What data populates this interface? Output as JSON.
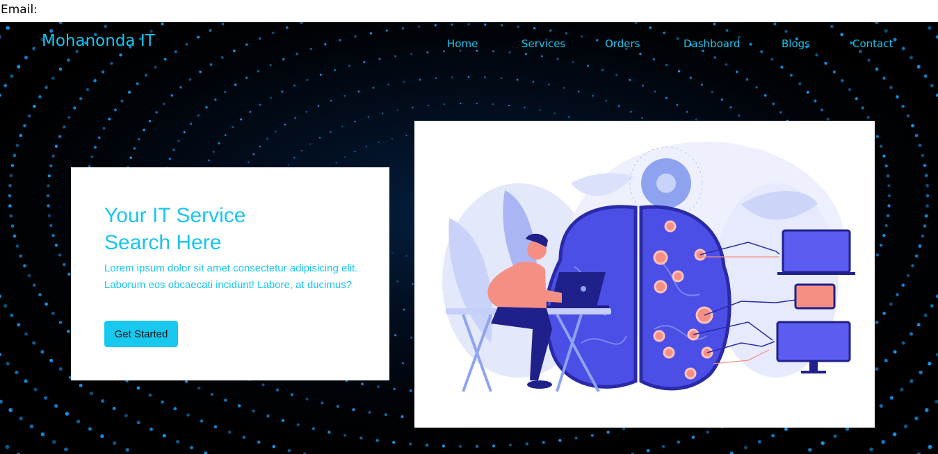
{
  "top_strip": {
    "email_label": "Email:"
  },
  "header": {
    "brand": "Mohanonda IT",
    "nav": [
      {
        "label": "Home"
      },
      {
        "label": "Services"
      },
      {
        "label": "Orders"
      },
      {
        "label": "Dashboard"
      },
      {
        "label": "Blogs"
      },
      {
        "label": "Contact"
      }
    ]
  },
  "hero": {
    "title_line1": "Your IT Service",
    "title_line2": "Search Here",
    "description": "Lorem ipsum dolor sit amet consectetur adipisicing elit. Laborum eos obcaecati incidunt! Labore, at ducimus?",
    "cta_label": "Get Started"
  },
  "colors": {
    "accent": "#19c5ee",
    "hero_bg": "#000000",
    "illustration_primary": "#4b4fe6",
    "illustration_highlight": "#f58f84"
  }
}
